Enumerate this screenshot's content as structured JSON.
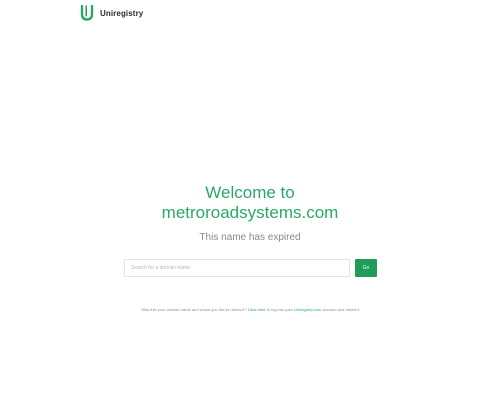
{
  "brand": {
    "name": "Uniregistry",
    "color": "#1f9b5a",
    "logo_icon": "uniregistry-u-icon"
  },
  "main": {
    "welcome_line": "Welcome to",
    "domain": "metroroadsystems.com",
    "status": "This name has expired"
  },
  "search": {
    "placeholder": "Search for a domain name",
    "value": "",
    "button_label": "Go"
  },
  "note": {
    "text_before": "Was this your domain name and would you like to renew it? ",
    "link1": "Click here",
    "text_middle": " to log into your ",
    "link2": "Uniregistry.com",
    "text_after": " account and renew it."
  },
  "colors": {
    "accent_green": "#2aa86a",
    "button_green": "#1f9b5a",
    "muted_text": "#8a8a8a"
  }
}
